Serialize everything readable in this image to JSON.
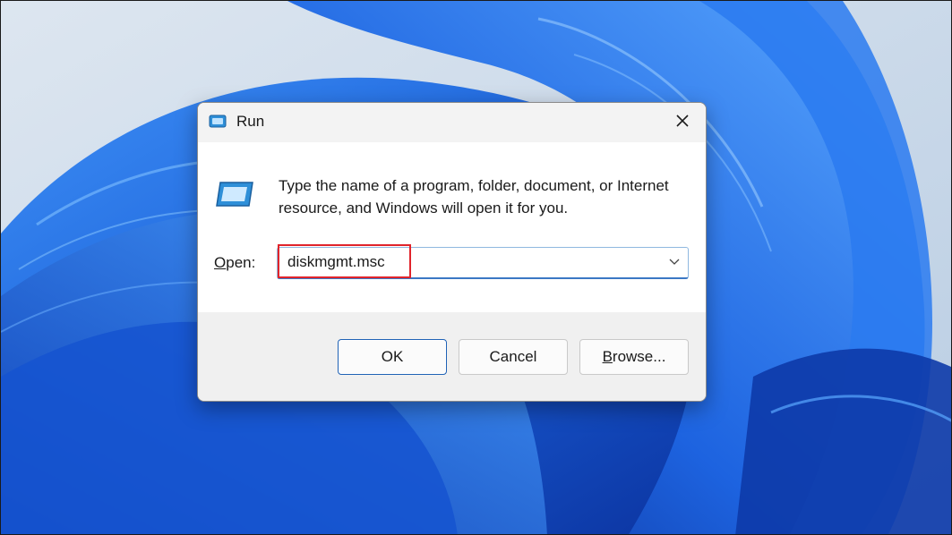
{
  "dialog": {
    "title": "Run",
    "title_icon": "run-icon",
    "close_icon": "close-icon",
    "description": "Type the name of a program, folder, document, or Internet resource, and Windows will open it for you.",
    "big_icon": "run-icon",
    "open_label_prefix": "O",
    "open_label_rest": "pen:",
    "input_value": "diskmgmt.msc",
    "dropdown_icon": "chevron-down-icon",
    "buttons": {
      "ok": "OK",
      "cancel": "Cancel",
      "browse_prefix": "B",
      "browse_rest": "rowse..."
    }
  },
  "colors": {
    "highlight": "#e0242b",
    "accent": "#1f62b5",
    "wallpaper_blue": "#1a5fd8"
  }
}
